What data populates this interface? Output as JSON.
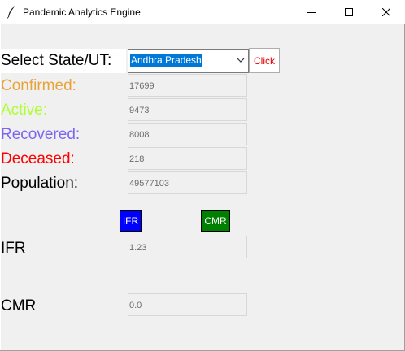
{
  "window": {
    "title": "Pandemic Analytics Engine",
    "minimize_glyph": "—",
    "maximize_glyph": "☐",
    "close_glyph": "✕"
  },
  "form": {
    "select_label": "Select State/UT:",
    "selected_state": "Andhra Pradesh",
    "click_label": "Click",
    "rows": {
      "confirmed": {
        "label": "Confirmed:",
        "value": "17699",
        "color": "#e8a33b"
      },
      "active": {
        "label": "Active:",
        "value": "9473",
        "color": "#adff2f"
      },
      "recovered": {
        "label": "Recovered:",
        "value": "8008",
        "color": "#7b68ee"
      },
      "deceased": {
        "label": "Deceased:",
        "value": "218",
        "color": "#ff0000"
      },
      "population": {
        "label": "Population:",
        "value": "49577103",
        "color": "#000000"
      }
    },
    "ifr_button": {
      "label": "IFR",
      "color": "#0000ff"
    },
    "cmr_button": {
      "label": "CMR",
      "color": "#008000"
    },
    "ifr": {
      "label": "IFR",
      "value": "1.23"
    },
    "cmr": {
      "label": "CMR",
      "value": "0.0"
    }
  },
  "icons": {
    "app": "feather-icon",
    "dropdown": "chevron-down-icon"
  }
}
